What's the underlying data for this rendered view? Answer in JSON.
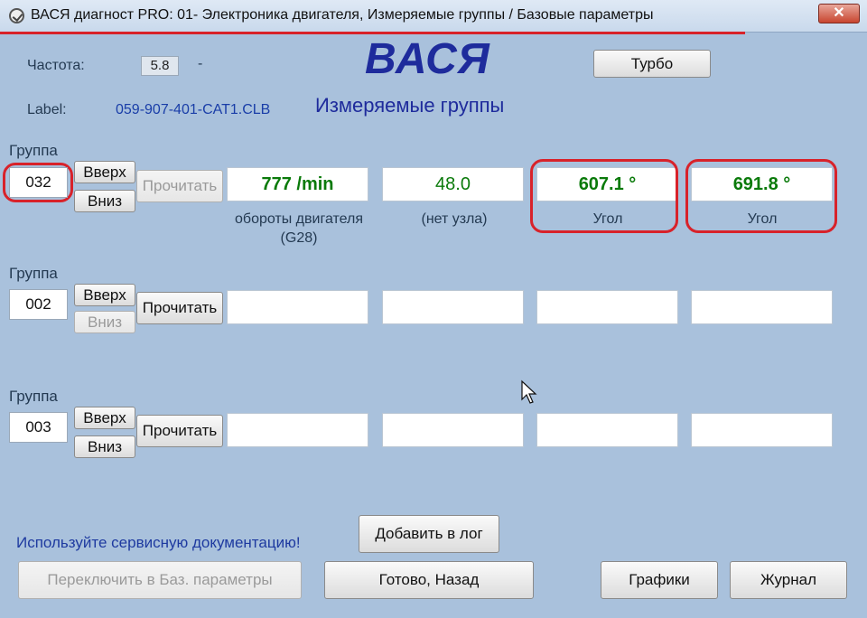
{
  "window": {
    "title": "ВАСЯ диагност PRO: 01- Электроника двигателя,  Измеряемые группы / Базовые параметры",
    "close_label": "✕"
  },
  "header": {
    "freq_label": "Частота:",
    "freq_value": "5.8",
    "freq_dash": "-",
    "label_label": "Label:",
    "label_value": "059-907-401-CAT1.CLB",
    "logo": "ВАСЯ",
    "subtitle": "Измеряемые группы",
    "turbo_label": "Турбо"
  },
  "groups": [
    {
      "label": "Группа",
      "number": "032",
      "up_label": "Вверх",
      "down_label": "Вниз",
      "read_label": "Прочитать",
      "fields": [
        {
          "value": "777 /min",
          "caption": "обороты двигателя (G28)"
        },
        {
          "value": "48.0",
          "caption": "(нет узла)"
        },
        {
          "value": "607.1 °",
          "caption": "Угол"
        },
        {
          "value": "691.8 °",
          "caption": "Угол"
        }
      ]
    },
    {
      "label": "Группа",
      "number": "002",
      "up_label": "Вверх",
      "down_label": "Вниз",
      "read_label": "Прочитать"
    },
    {
      "label": "Группа",
      "number": "003",
      "up_label": "Вверх",
      "down_label": "Вниз",
      "read_label": "Прочитать"
    }
  ],
  "footer": {
    "hint": "Используйте сервисную документацию!",
    "add_log_label": "Добавить в лог",
    "switch_label": "Переключить в Баз. параметры",
    "done_label": "Готово, Назад",
    "graphs_label": "Графики",
    "journal_label": "Журнал"
  },
  "colors": {
    "background": "#a9c1dc",
    "value_green": "#0a7a0a",
    "highlight_red": "#d8222a",
    "logo_blue": "#1e2b9c"
  }
}
